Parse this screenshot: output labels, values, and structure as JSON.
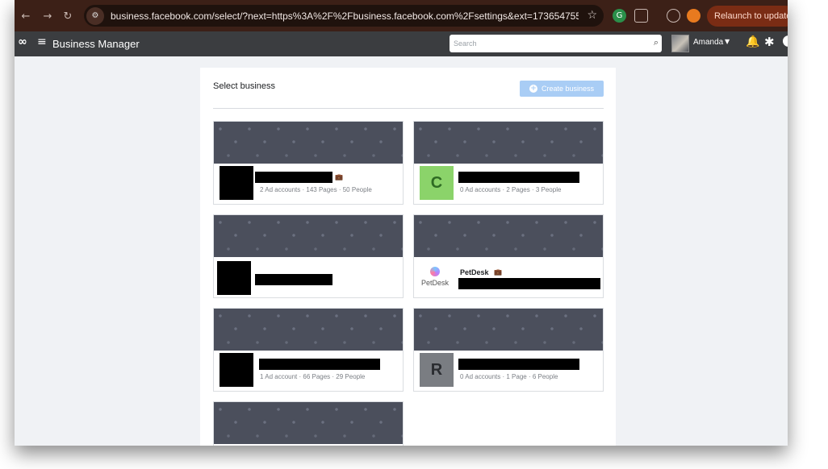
{
  "browser": {
    "back_glyph": "←",
    "forward_glyph": "→",
    "reload_glyph": "↻",
    "site_info_glyph": "⚙",
    "url": "business.facebook.com/select/?next=https%3A%2F%2Fbusiness.facebook.com%2Fsettings&ext=1736547556&hash=...",
    "star_glyph": "☆",
    "relaunch_label": "Relaunch to update",
    "accent": "#7a2c14"
  },
  "fb_bar": {
    "logo_glyph": "∞",
    "menu_glyph": "≡",
    "title": "Business Manager",
    "search_placeholder": "Search",
    "search_glyph": "⌕",
    "user_name": "Amanda",
    "caret_glyph": "▼",
    "bell_glyph": "🔔",
    "gear_glyph": "✱"
  },
  "panel": {
    "title": "Select business",
    "create_label": "Create business",
    "create_glyph": "+"
  },
  "cards": [
    {
      "meta": "2 Ad accounts · 143 Pages · 50 People"
    },
    {
      "thumb_letter": "C",
      "thumb_color": "#8bd36a",
      "letter_color": "#2e6b23",
      "meta": "0 Ad accounts · 2 Pages · 3 People"
    },
    {
      "meta": ""
    },
    {
      "name": "PetDesk",
      "logo_text": "PetDesk",
      "meta": ""
    },
    {
      "meta": "1 Ad account · 66 Pages · 29 People"
    },
    {
      "thumb_letter": "R",
      "thumb_color": "#7a7d82",
      "letter_color": "#2a2c30",
      "meta": "0 Ad accounts · 1 Page · 6 People"
    },
    {
      "meta": ""
    }
  ]
}
